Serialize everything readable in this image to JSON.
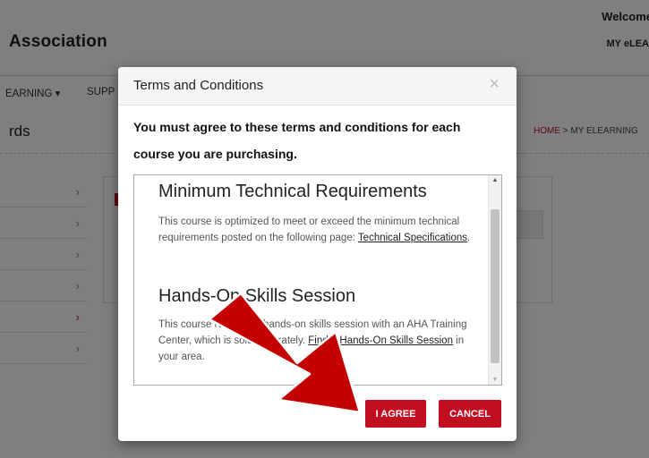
{
  "site": {
    "title": "Association",
    "welcome": "Welcome",
    "my_elearning": "MY eLEA"
  },
  "nav": {
    "elearning_label": "EARNING ▾",
    "support_label": "SUPP"
  },
  "page": {
    "heading": "rds",
    "breadcrumb_home": "HOME",
    "breadcrumb_sep": " > ",
    "breadcrumb_current": "MY ELEARNING"
  },
  "side_menu": {
    "chevron": "›"
  },
  "modal": {
    "title": "Terms and Conditions",
    "close_symbol": "×",
    "intro": "You must agree to these terms and conditions for each course you are purchasing.",
    "requirements_heading": "Minimum Technical Requirements",
    "requirements_text": "This course is optimized to meet or exceed the minimum technical requirements posted on the following page: ",
    "requirements_link": "Technical Specifications",
    "requirements_period": ".",
    "skills_heading": "Hands-On Skills Session",
    "skills_text_1": "This course requires a hands-on skills session with an AHA Training Center, which is sold separately. ",
    "skills_link": "Find a Hands-On Skills Session",
    "skills_text_2": " in your area.",
    "agree_label": "I AGREE",
    "cancel_label": "CANCEL"
  },
  "colors": {
    "brand_red": "#c10e21",
    "arrow_red": "#c50000"
  }
}
